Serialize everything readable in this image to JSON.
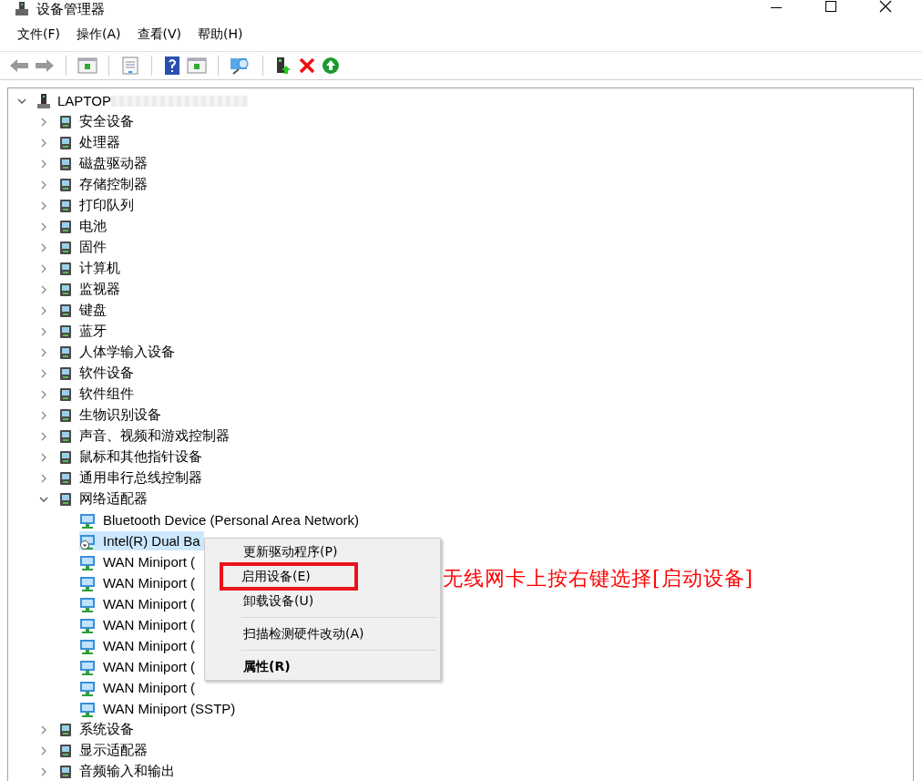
{
  "window": {
    "title": "设备管理器"
  },
  "menu": [
    "文件(F)",
    "操作(A)",
    "查看(V)",
    "帮助(H)"
  ],
  "tree": {
    "label": "LAPTOP",
    "expanded": true,
    "children": [
      {
        "label": "安全设备",
        "expanded": false
      },
      {
        "label": "处理器",
        "expanded": false
      },
      {
        "label": "磁盘驱动器",
        "expanded": false
      },
      {
        "label": "存储控制器",
        "expanded": false
      },
      {
        "label": "打印队列",
        "expanded": false
      },
      {
        "label": "电池",
        "expanded": false
      },
      {
        "label": "固件",
        "expanded": false
      },
      {
        "label": "计算机",
        "expanded": false
      },
      {
        "label": "监视器",
        "expanded": false
      },
      {
        "label": "键盘",
        "expanded": false
      },
      {
        "label": "蓝牙",
        "expanded": false
      },
      {
        "label": "人体学输入设备",
        "expanded": false
      },
      {
        "label": "软件设备",
        "expanded": false
      },
      {
        "label": "软件组件",
        "expanded": false
      },
      {
        "label": "生物识别设备",
        "expanded": false
      },
      {
        "label": "声音、视频和游戏控制器",
        "expanded": false
      },
      {
        "label": "鼠标和其他指针设备",
        "expanded": false
      },
      {
        "label": "通用串行总线控制器",
        "expanded": false
      },
      {
        "label": "网络适配器",
        "expanded": true,
        "children": [
          {
            "label": "Bluetooth Device (Personal Area Network)",
            "selected": false,
            "disabled": false
          },
          {
            "label": "Intel(R) Dual Ba",
            "selected": true,
            "disabled": true
          },
          {
            "label": "WAN Miniport (",
            "selected": false,
            "disabled": false
          },
          {
            "label": "WAN Miniport (",
            "selected": false,
            "disabled": false
          },
          {
            "label": "WAN Miniport (",
            "selected": false,
            "disabled": false
          },
          {
            "label": "WAN Miniport (",
            "selected": false,
            "disabled": false
          },
          {
            "label": "WAN Miniport (",
            "selected": false,
            "disabled": false
          },
          {
            "label": "WAN Miniport (",
            "selected": false,
            "disabled": false
          },
          {
            "label": "WAN Miniport (",
            "selected": false,
            "disabled": false
          },
          {
            "label": "WAN Miniport (SSTP)",
            "selected": false,
            "disabled": false
          }
        ]
      },
      {
        "label": "系统设备",
        "expanded": false
      },
      {
        "label": "显示适配器",
        "expanded": false
      },
      {
        "label": "音频输入和输出",
        "expanded": false
      }
    ]
  },
  "context_menu": {
    "items": [
      {
        "kind": "item",
        "label": "更新驱动程序(P)",
        "highlighted": false
      },
      {
        "kind": "item",
        "label": "启用设备(E)",
        "highlighted": true
      },
      {
        "kind": "item",
        "label": "卸载设备(U)",
        "highlighted": false
      },
      {
        "kind": "separator"
      },
      {
        "kind": "item",
        "label": "扫描检测硬件改动(A)",
        "highlighted": false
      },
      {
        "kind": "separator"
      },
      {
        "kind": "default",
        "label": "属性(R)",
        "highlighted": false
      }
    ]
  },
  "annotation": "无线网卡上按右键选择[启动设备]"
}
